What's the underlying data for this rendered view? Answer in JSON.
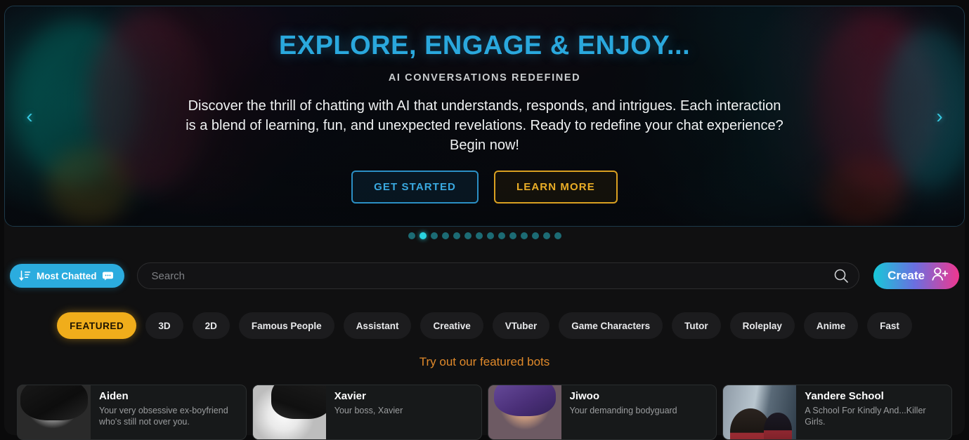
{
  "hero": {
    "title": "EXPLORE, ENGAGE & ENJOY...",
    "subtitle": "AI CONVERSATIONS REDEFINED",
    "description": "Discover the thrill of chatting with AI that understands, responds, and intrigues. Each interaction is a blend of learning, fun, and unexpected revelations. Ready to redefine your chat experience? Begin now!",
    "primary_button": "GET STARTED",
    "secondary_button": "LEARN MORE",
    "prev_arrow": "‹",
    "next_arrow": "›",
    "title_color": "#2aa8dd",
    "primary_button_color": "#3aa9e0",
    "secondary_button_color": "#e9ad26"
  },
  "carousel": {
    "total_dots": 14,
    "active_index": 1,
    "active_color": "#2ad4e0",
    "inactive_color": "#1c6b74"
  },
  "toolbar": {
    "sort_label": "Most Chatted",
    "sort_icon": "sort-descending-icon",
    "sort_badge_icon": "chat-bubble-icon",
    "sort_color": "#2bacdf",
    "search_placeholder": "Search",
    "search_value": "",
    "search_icon": "search-icon",
    "create_label": "Create",
    "create_icon": "add-user-icon",
    "create_gradient_start": "#17c9d8",
    "create_gradient_end": "#f0378f"
  },
  "categories": {
    "active": "FEATURED",
    "active_color": "#f0ad1b",
    "items": [
      {
        "label": "FEATURED",
        "active": true
      },
      {
        "label": "3D",
        "active": false
      },
      {
        "label": "2D",
        "active": false
      },
      {
        "label": "Famous People",
        "active": false
      },
      {
        "label": "Assistant",
        "active": false
      },
      {
        "label": "Creative",
        "active": false
      },
      {
        "label": "VTuber",
        "active": false
      },
      {
        "label": "Game Characters",
        "active": false
      },
      {
        "label": "Tutor",
        "active": false
      },
      {
        "label": "Roleplay",
        "active": false
      },
      {
        "label": "Anime",
        "active": false
      },
      {
        "label": "Fast",
        "active": false
      }
    ]
  },
  "section": {
    "heading": "Try out our featured bots",
    "heading_color": "#e0892a"
  },
  "bots": [
    {
      "name": "Aiden",
      "description": "Your very obsessive ex-boyfriend who's still not over you.",
      "thumb_class": "thumb-aiden"
    },
    {
      "name": "Xavier",
      "description": "Your boss, Xavier",
      "thumb_class": "thumb-xavier"
    },
    {
      "name": "Jiwoo",
      "description": "Your demanding bodyguard",
      "thumb_class": "thumb-jiwoo"
    },
    {
      "name": "Yandere School",
      "description": "A School For Kindly And...Killer Girls.",
      "thumb_class": "thumb-yandere"
    }
  ]
}
